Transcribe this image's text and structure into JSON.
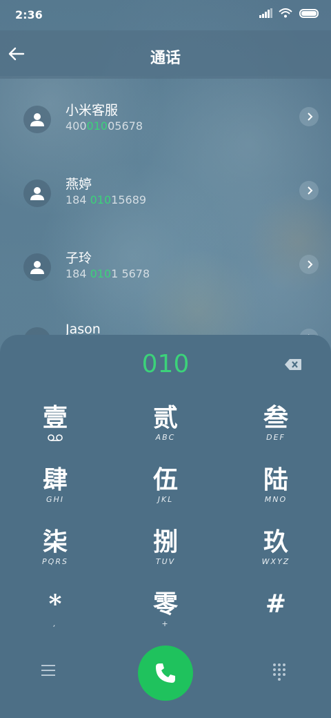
{
  "status": {
    "time": "2:36"
  },
  "header": {
    "title": "通话"
  },
  "contacts": [
    {
      "name": "小米客服",
      "num_pre": "400",
      "num_hl": "010",
      "num_post": "05678"
    },
    {
      "name": "燕婷",
      "num_pre": "184 ",
      "num_hl": "010",
      "num_post": "15689"
    },
    {
      "name": "子玲",
      "num_pre": "184 ",
      "num_hl": "010",
      "num_post": "1 5678"
    },
    {
      "name": "Jason",
      "num_pre": "",
      "num_hl": "",
      "num_post": ""
    }
  ],
  "dialer": {
    "entry": "010"
  },
  "keys": [
    {
      "main": "壹",
      "sub": "voicemail"
    },
    {
      "main": "贰",
      "sub": "ABC"
    },
    {
      "main": "叁",
      "sub": "DEF"
    },
    {
      "main": "肆",
      "sub": "GHI"
    },
    {
      "main": "伍",
      "sub": "JKL"
    },
    {
      "main": "陆",
      "sub": "MNO"
    },
    {
      "main": "柒",
      "sub": "PQRS"
    },
    {
      "main": "捌",
      "sub": "TUV"
    },
    {
      "main": "玖",
      "sub": "WXYZ"
    },
    {
      "main": "*",
      "sub": ","
    },
    {
      "main": "零",
      "sub": "+"
    },
    {
      "main": "#",
      "sub": ""
    }
  ],
  "icons": {
    "back": "arrow-left-icon",
    "contact_avatar": "person-icon",
    "chevron": "chevron-right-icon",
    "delete": "backspace-icon",
    "call": "phone-icon",
    "menu": "menu-icon",
    "dialpad": "dialpad-icon",
    "voicemail": "voicemail-icon"
  },
  "colors": {
    "accent": "#3cd27a",
    "call_button": "#1fc25d",
    "panel": "#4d6f86"
  }
}
